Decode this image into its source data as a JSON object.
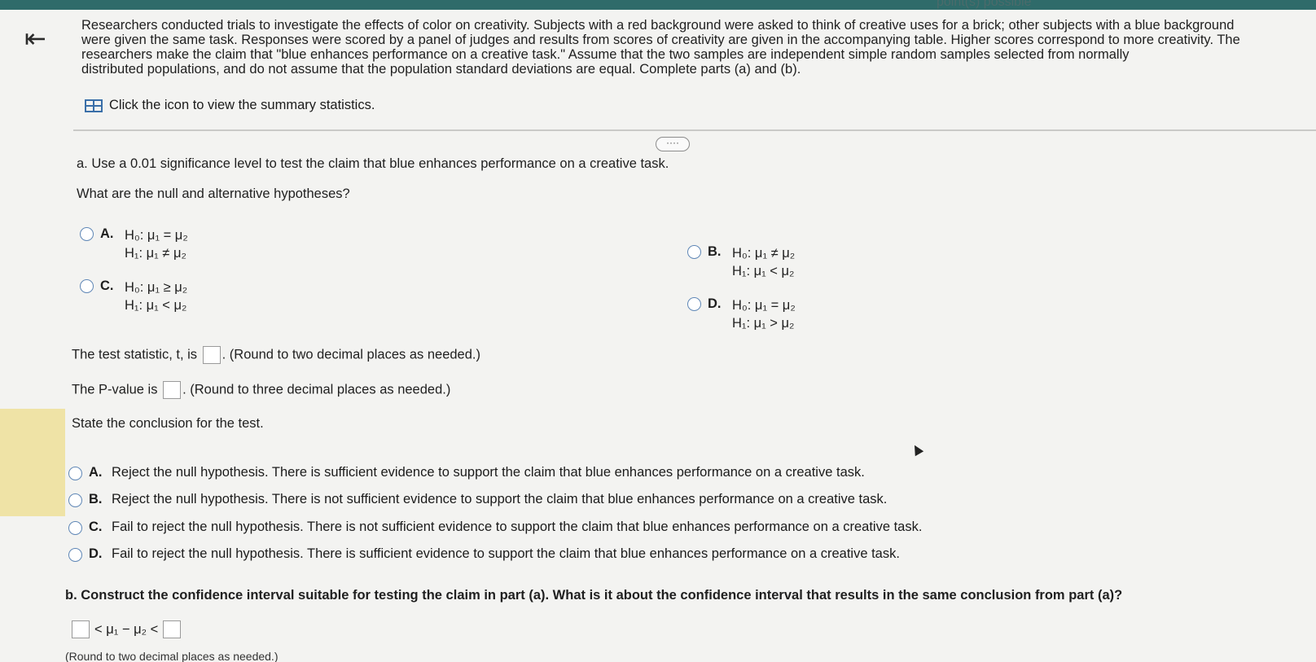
{
  "header": {
    "status_text": "point(s) possible"
  },
  "icons": {
    "back": "back-arrow-icon",
    "table": "table-icon",
    "more": "more-icon",
    "cursor": "mouse-cursor-icon"
  },
  "intro": {
    "line1": "Researchers conducted trials to investigate the effects of color on creativity. Subjects with a red background were asked to think of creative uses for a brick; other subjects with a blue background",
    "line2": "were given the same task. Responses were scored by a panel of judges and results from scores of creativity are given in the accompanying table. Higher scores correspond to more creativity. The",
    "line3": "researchers make the claim that \"blue enhances performance on a creative task.\" Assume that the two samples are independent simple random samples selected from normally",
    "line4": "distributed populations, and do not assume that the population standard deviations are equal. Complete parts (a) and (b).",
    "summary_link": "Click the icon to view the summary statistics."
  },
  "more_button": "····",
  "part_a": {
    "prompt": "a. Use a 0.01 significance level to test the claim that blue enhances performance on a creative task.",
    "question": "What are the null and alternative hypotheses?",
    "options": [
      {
        "letter": "A.",
        "h0": "H₀: μ₁ = μ₂",
        "h1": "H₁: μ₁ ≠ μ₂"
      },
      {
        "letter": "B.",
        "h0": "H₀: μ₁ ≠ μ₂",
        "h1": "H₁: μ₁ < μ₂"
      },
      {
        "letter": "C.",
        "h0": "H₀: μ₁ ≥ μ₂",
        "h1": "H₁: μ₁ < μ₂"
      },
      {
        "letter": "D.",
        "h0": "H₀: μ₁ = μ₂",
        "h1": "H₁: μ₁ > μ₂"
      }
    ],
    "test_stat_prefix": "The test statistic, t, is",
    "test_stat_suffix": ". (Round to two decimal places as needed.)",
    "pvalue_prefix": "The P-value is",
    "pvalue_suffix": ". (Round to three decimal places as needed.)",
    "conclusion_prompt": "State the conclusion for the test.",
    "conclusions": [
      {
        "letter": "A.",
        "text": "Reject the null hypothesis. There is sufficient evidence to support the claim that blue enhances performance on a creative task."
      },
      {
        "letter": "B.",
        "text": "Reject the null hypothesis. There is not sufficient evidence to support the claim that blue enhances performance on a creative task."
      },
      {
        "letter": "C.",
        "text": "Fail to reject the null hypothesis. There is not sufficient evidence to support the claim that blue enhances performance on a creative task."
      },
      {
        "letter": "D.",
        "text": "Fail to reject the null hypothesis. There is sufficient evidence to support the claim that blue enhances performance on a creative task."
      }
    ]
  },
  "part_b": {
    "prompt": "b. Construct the confidence interval suitable for testing the claim in part (a). What is it about the confidence interval that results in the same conclusion from part (a)?",
    "interval_middle": "< μ₁ − μ₂ <",
    "footnote": "(Round to two decimal places as needed.)"
  }
}
